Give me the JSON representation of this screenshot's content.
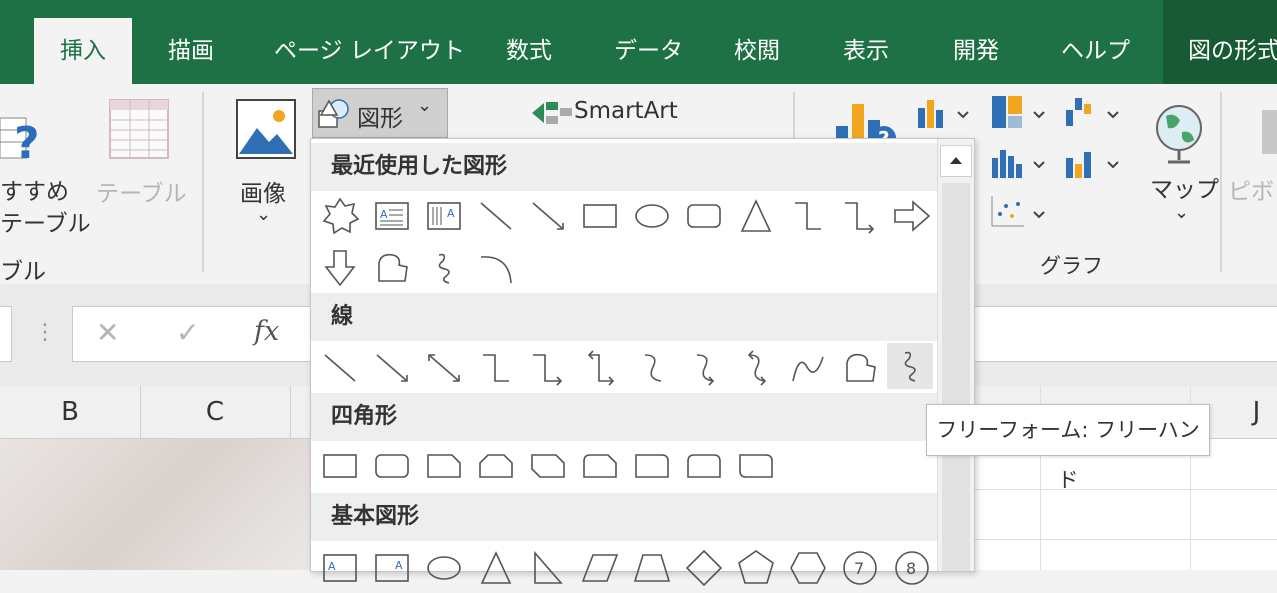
{
  "tabs": {
    "items": [
      "挿入",
      "描画",
      "ページ レイアウト",
      "数式",
      "データ",
      "校閲",
      "表示",
      "開発",
      "ヘルプ",
      "図の形式"
    ],
    "active_index": 0
  },
  "ribbon": {
    "recommended_table_line1": "すすめ",
    "recommended_table_line2": "テーブル",
    "group_table_label": "ブル",
    "table_button": "テーブル",
    "image_button": "画像",
    "shapes_button": "図形",
    "smartart_button": "SmartArt",
    "map_button": "マップ",
    "pivot_button": "ピボッ",
    "chart_group_label": "グラフ"
  },
  "formula_bar": {
    "cancel": "✕",
    "enter": "✓",
    "fx": "fx"
  },
  "columns": [
    "B",
    "C",
    "J"
  ],
  "shapes_menu": {
    "sections": [
      "最近使用した図形",
      "線",
      "四角形",
      "基本図形"
    ]
  },
  "tooltip": "フリーフォーム: フリーハンド",
  "colors": {
    "tab_bar": "#1e7145",
    "active_tab_text": "#1e7145",
    "format_tab": "#185a36"
  }
}
